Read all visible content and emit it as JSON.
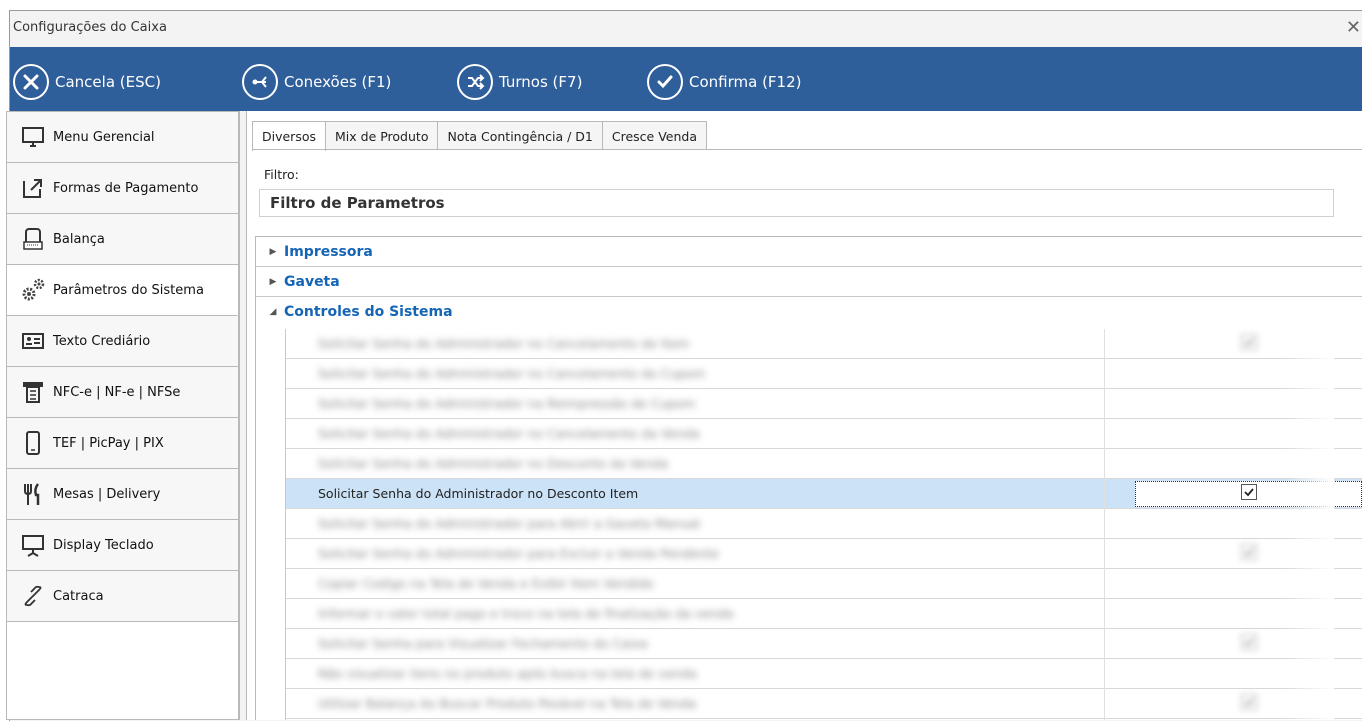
{
  "window": {
    "title": "Configurações do Caixa",
    "close_symbol": "✕"
  },
  "toolbar": {
    "cancel_label": "Cancela (ESC)",
    "connections_label": "Conexões (F1)",
    "shifts_label": "Turnos (F7)",
    "confirm_label": "Confirma (F12)"
  },
  "sidebar": {
    "items": [
      {
        "label": "Menu Gerencial",
        "icon": "monitor-icon"
      },
      {
        "label": "Formas de Pagamento",
        "icon": "external-link-icon"
      },
      {
        "label": "Balança",
        "icon": "scale-icon"
      },
      {
        "label": "Parâmetros do Sistema",
        "icon": "gears-icon"
      },
      {
        "label": "Texto Crediário",
        "icon": "id-card-icon"
      },
      {
        "label": "NFC-e | NF-e | NFSe",
        "icon": "receipt-printer-icon"
      },
      {
        "label": "TEF | PicPay | PIX",
        "icon": "smartphone-icon"
      },
      {
        "label": "Mesas | Delivery",
        "icon": "cutlery-icon"
      },
      {
        "label": "Display Teclado",
        "icon": "display-icon"
      },
      {
        "label": "Catraca",
        "icon": "link-icon"
      }
    ],
    "active_index": 3
  },
  "tabs": [
    {
      "label": "Diversos",
      "active": true
    },
    {
      "label": "Mix de Produto",
      "active": false
    },
    {
      "label": "Nota Contingência / D1",
      "active": false
    },
    {
      "label": "Cresce Venda",
      "active": false
    }
  ],
  "filter": {
    "label": "Filtro:",
    "value": "Filtro de Parametros"
  },
  "groups": [
    {
      "label": "Impressora",
      "expanded": false,
      "arrow": "▶"
    },
    {
      "label": "Gaveta",
      "expanded": false,
      "arrow": "▶"
    },
    {
      "label": "Controles do Sistema",
      "expanded": true,
      "arrow": "◢"
    }
  ],
  "rows": [
    {
      "text": "Solicitar Senha do Administrador no Cancelamento de Item",
      "blurred": true,
      "checked": true
    },
    {
      "text": "Solicitar Senha do Administrador no Cancelamento do Cupom",
      "blurred": true,
      "checked": false
    },
    {
      "text": "Solicitar Senha do Administrador na Reimpressão de Cupom",
      "blurred": true,
      "checked": false
    },
    {
      "text": "Solicitar Senha do Administrador no Cancelamento da Venda",
      "blurred": true,
      "checked": false
    },
    {
      "text": "Solicitar Senha do Administrador no Desconto da Venda",
      "blurred": true,
      "checked": false
    },
    {
      "text": "Solicitar Senha do Administrador no Desconto Item",
      "blurred": false,
      "checked": true,
      "selected": true
    },
    {
      "text": "Solicitar Senha do Administrador para Abrir a Gaveta Manual",
      "blurred": true,
      "checked": false
    },
    {
      "text": "Solicitar Senha do Administrador para Excluir a Venda Pendente",
      "blurred": true,
      "checked": true
    },
    {
      "text": "Copiar Codigo na Tela de Venda e Exibir Item Vendido",
      "blurred": true,
      "checked": false
    },
    {
      "text": "Informar o valor total pago e troco na tela de finalização da venda",
      "blurred": true,
      "checked": false
    },
    {
      "text": "Solicitar Senha para Visualizar Fechamento do Caixa",
      "blurred": true,
      "checked": true
    },
    {
      "text": "Não visualizar itens no produto após busca na tela de venda",
      "blurred": true,
      "checked": false
    },
    {
      "text": "Utilizar Balança Ao Buscar Produto Pesável na Tela de Venda",
      "blurred": true,
      "checked": true
    }
  ]
}
